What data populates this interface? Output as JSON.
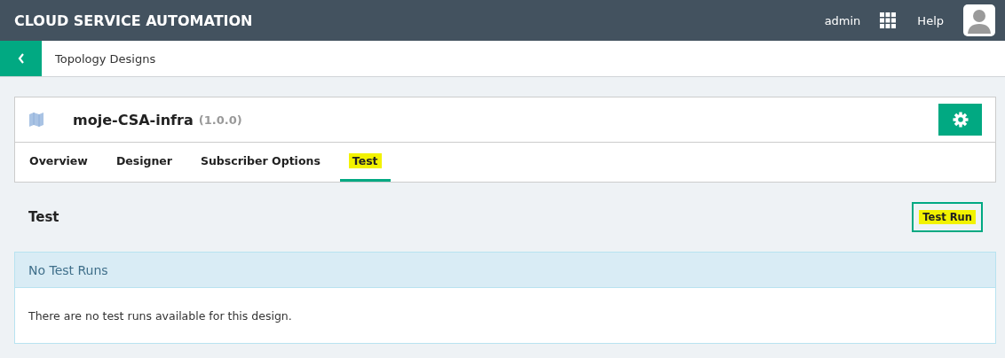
{
  "header": {
    "title": "CLOUD SERVICE AUTOMATION",
    "user": "admin",
    "help": "Help"
  },
  "breadcrumb": {
    "label": "Topology Designs"
  },
  "design": {
    "name": "moje-CSA-infra",
    "version": "(1.0.0)"
  },
  "tabs": [
    {
      "label": "Overview",
      "selected": false,
      "highlighted": false
    },
    {
      "label": "Designer",
      "selected": false,
      "highlighted": false
    },
    {
      "label": "Subscriber Options",
      "selected": false,
      "highlighted": false
    },
    {
      "label": "Test",
      "selected": true,
      "highlighted": true
    }
  ],
  "section": {
    "title": "Test",
    "button": {
      "label": "Test Run",
      "highlighted": true
    }
  },
  "notice": {
    "title": "No Test Runs",
    "message": "There are no test runs available for this design."
  }
}
